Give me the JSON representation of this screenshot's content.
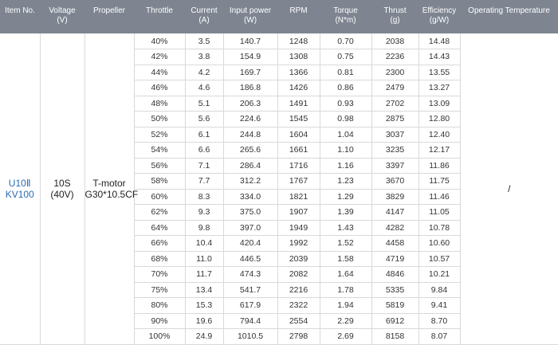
{
  "headers": [
    {
      "line1": "Item No.",
      "line2": ""
    },
    {
      "line1": "Voltage",
      "line2": "(V)"
    },
    {
      "line1": "Propeller",
      "line2": ""
    },
    {
      "line1": "Throttle",
      "line2": ""
    },
    {
      "line1": "Current",
      "line2": "(A)"
    },
    {
      "line1": "Input power",
      "line2": "(W)"
    },
    {
      "line1": "RPM",
      "line2": ""
    },
    {
      "line1": "Torque",
      "line2": "(N*m)"
    },
    {
      "line1": "Thrust",
      "line2": "(g)"
    },
    {
      "line1": "Efficiency",
      "line2": "(g/W)"
    },
    {
      "line1": "Operating Temperature",
      "line2": ""
    }
  ],
  "item": {
    "line1": "U10Ⅱ",
    "line2": "KV100"
  },
  "voltage": {
    "line1": "10S",
    "line2": "(40V)"
  },
  "propeller": {
    "line1": "T-motor",
    "line2": "G30*10.5CF"
  },
  "operating_temperature": "/",
  "rows": [
    [
      "40%",
      "3.5",
      "140.7",
      "1248",
      "0.70",
      "2038",
      "14.48"
    ],
    [
      "42%",
      "3.8",
      "154.9",
      "1308",
      "0.75",
      "2236",
      "14.43"
    ],
    [
      "44%",
      "4.2",
      "169.7",
      "1366",
      "0.81",
      "2300",
      "13.55"
    ],
    [
      "46%",
      "4.6",
      "186.8",
      "1426",
      "0.86",
      "2479",
      "13.27"
    ],
    [
      "48%",
      "5.1",
      "206.3",
      "1491",
      "0.93",
      "2702",
      "13.09"
    ],
    [
      "50%",
      "5.6",
      "224.6",
      "1545",
      "0.98",
      "2875",
      "12.80"
    ],
    [
      "52%",
      "6.1",
      "244.8",
      "1604",
      "1.04",
      "3037",
      "12.40"
    ],
    [
      "54%",
      "6.6",
      "265.6",
      "1661",
      "1.10",
      "3235",
      "12.17"
    ],
    [
      "56%",
      "7.1",
      "286.4",
      "1716",
      "1.16",
      "3397",
      "11.86"
    ],
    [
      "58%",
      "7.7",
      "312.2",
      "1767",
      "1.23",
      "3670",
      "11.75"
    ],
    [
      "60%",
      "8.3",
      "334.0",
      "1821",
      "1.29",
      "3829",
      "11.46"
    ],
    [
      "62%",
      "9.3",
      "375.0",
      "1907",
      "1.39",
      "4147",
      "11.05"
    ],
    [
      "64%",
      "9.8",
      "397.0",
      "1949",
      "1.43",
      "4282",
      "10.78"
    ],
    [
      "66%",
      "10.4",
      "420.4",
      "1992",
      "1.52",
      "4458",
      "10.60"
    ],
    [
      "68%",
      "11.0",
      "446.5",
      "2039",
      "1.58",
      "4719",
      "10.57"
    ],
    [
      "70%",
      "11.7",
      "474.3",
      "2082",
      "1.64",
      "4846",
      "10.21"
    ],
    [
      "75%",
      "13.4",
      "541.7",
      "2216",
      "1.78",
      "5335",
      "9.84"
    ],
    [
      "80%",
      "15.3",
      "617.9",
      "2322",
      "1.94",
      "5819",
      "9.41"
    ],
    [
      "90%",
      "19.6",
      "794.4",
      "2554",
      "2.29",
      "6912",
      "8.70"
    ],
    [
      "100%",
      "24.9",
      "1010.5",
      "2798",
      "2.69",
      "8158",
      "8.07"
    ]
  ]
}
